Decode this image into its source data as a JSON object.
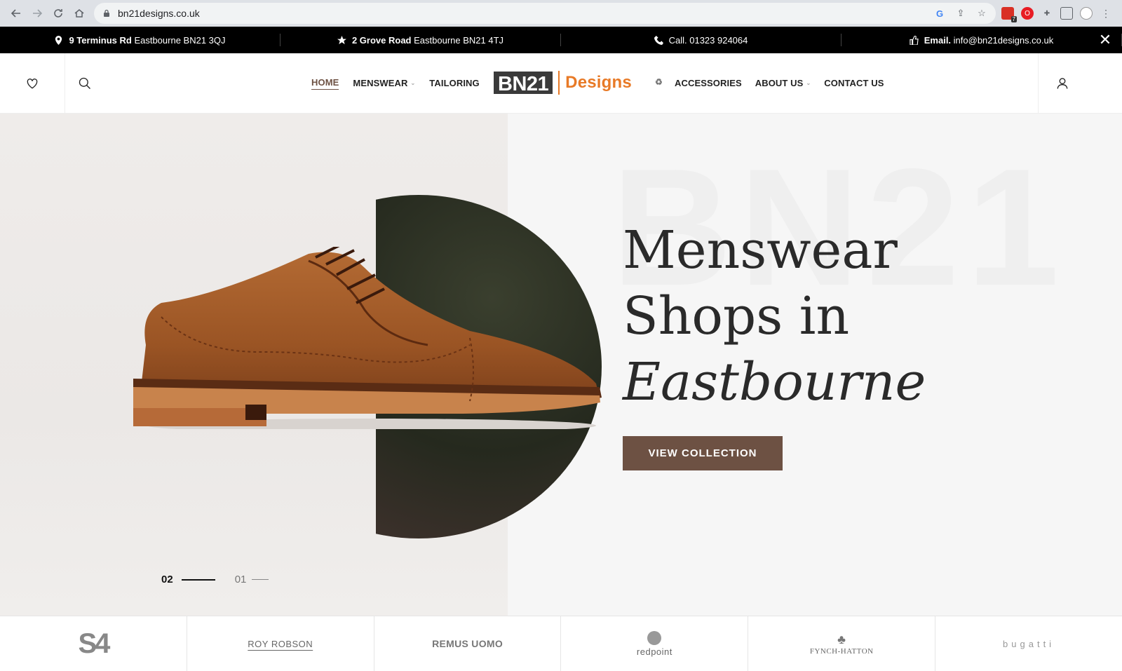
{
  "browser": {
    "url": "bn21designs.co.uk",
    "ext_badge": "7"
  },
  "info_bar": {
    "address1_bold": "9 Terminus Rd",
    "address1_rest": "Eastbourne BN21 3QJ",
    "address2_bold": "2 Grove Road",
    "address2_rest": "Eastbourne BN21 4TJ",
    "phone": "Call. 01323 924064",
    "email_label": "Email.",
    "email": "info@bn21designs.co.uk",
    "close": "✕"
  },
  "nav": {
    "home": "HOME",
    "menswear": "MENSWEAR",
    "tailoring": "TAILORING",
    "accessories": "ACCESSORIES",
    "about": "ABOUT US",
    "contact": "CONTACT US"
  },
  "logo": {
    "box": "BN21",
    "designs": "Designs"
  },
  "hero": {
    "bg_text": "BN21",
    "line1": "Menswear",
    "line2": "Shops in",
    "line3": "Eastbourne",
    "cta": "VIEW COLLECTION",
    "slide_current": "02",
    "slide_next": "01"
  },
  "brands": [
    "S4",
    "ROY ROBSON",
    "REMUS UOMO",
    "redpoint",
    "FYNCH-HATTON",
    "bugatti"
  ],
  "colors": {
    "accent": "#6d5143",
    "logo_orange": "#e87a27"
  }
}
